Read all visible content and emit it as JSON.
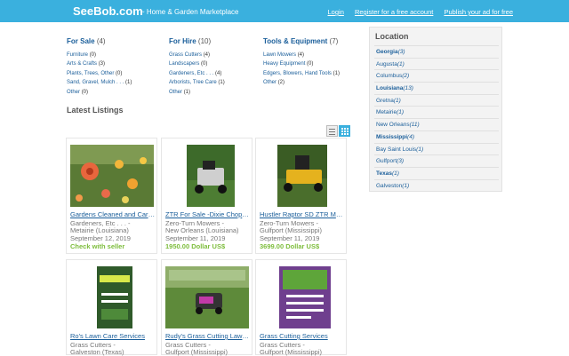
{
  "header": {
    "brand": "SeeBob.com",
    "tagline": "~ Home & Garden Marketplace",
    "links": {
      "login": "Login",
      "register": "Register for a free account",
      "publish": "Publish your ad for free"
    }
  },
  "categories": [
    {
      "name": "For Sale",
      "count": "(4)",
      "items": [
        {
          "name": "Furniture",
          "count": "(0)"
        },
        {
          "name": "Arts & Crafts",
          "count": "(3)"
        },
        {
          "name": "Plants, Trees, Other",
          "count": "(0)"
        },
        {
          "name": "Sand, Gravel, Mulch . . .",
          "count": "(1)"
        },
        {
          "name": "Other",
          "count": "(0)"
        }
      ]
    },
    {
      "name": "For Hire",
      "count": "(10)",
      "items": [
        {
          "name": "Grass Cutters",
          "count": "(4)"
        },
        {
          "name": "Landscapers",
          "count": "(0)"
        },
        {
          "name": "Gardeners, Etc . . .",
          "count": "(4)"
        },
        {
          "name": "Arborists, Tree Care",
          "count": "(1)"
        },
        {
          "name": "Other",
          "count": "(1)"
        }
      ]
    },
    {
      "name": "Tools & Equipment",
      "count": "(7)",
      "items": [
        {
          "name": "Lawn Mowers",
          "count": "(4)"
        },
        {
          "name": "Heavy Equipment",
          "count": "(0)"
        },
        {
          "name": "Edgers, Blowers, Hand Tools",
          "count": "(1)"
        },
        {
          "name": "Other",
          "count": "(2)"
        }
      ]
    }
  ],
  "latest_title": "Latest Listings",
  "listings": [
    {
      "title": "Gardens Cleaned and Cared For",
      "cat": "Gardeners, Etc . . . -",
      "loc": "Metairie (Louisiana)",
      "date": "September 12, 2019",
      "price": "Check with seller"
    },
    {
      "title": "ZTR For Sale -Dixie Chopper",
      "cat": "Zero-Turn Mowers -",
      "loc": "New Orleans (Louisiana)",
      "date": "September 11, 2019",
      "price": "1950.00 Dollar US$"
    },
    {
      "title": "Hustler Raptor SD ZTR Mower",
      "cat": "Zero-Turn Mowers -",
      "loc": "Gulfport (Mississippi)",
      "date": "September 11, 2019",
      "price": "3699.00 Dollar US$"
    },
    {
      "title": "Ro's Lawn Care Services",
      "cat": "Grass Cutters -",
      "loc": "Galveston (Texas)",
      "date": "",
      "price": ""
    },
    {
      "title": "Rudy's Grass Cutting Lawn Service",
      "cat": "Grass Cutters -",
      "loc": "Gulfport (Mississippi)",
      "date": "",
      "price": ""
    },
    {
      "title": "Grass Cutting Services",
      "cat": "Grass Cutters -",
      "loc": "Gulfport (Mississippi)",
      "date": "",
      "price": ""
    }
  ],
  "location": {
    "title": "Location",
    "rows": [
      {
        "name": "Georgia",
        "count": "(3)",
        "state": true
      },
      {
        "name": "Augusta",
        "count": "(1)",
        "state": false
      },
      {
        "name": "Columbus",
        "count": "(2)",
        "state": false
      },
      {
        "name": "Louisiana",
        "count": "(13)",
        "state": true
      },
      {
        "name": "Gretna",
        "count": "(1)",
        "state": false
      },
      {
        "name": "Metairie",
        "count": "(1)",
        "state": false
      },
      {
        "name": "New Orleans",
        "count": "(11)",
        "state": false
      },
      {
        "name": "Mississippi",
        "count": "(4)",
        "state": true
      },
      {
        "name": "Bay Saint Louis",
        "count": "(1)",
        "state": false
      },
      {
        "name": "Gulfport",
        "count": "(3)",
        "state": false
      },
      {
        "name": "Texas",
        "count": "(1)",
        "state": true
      },
      {
        "name": "Galveston",
        "count": "(1)",
        "state": false
      }
    ]
  },
  "colors": {
    "accent": "#3ab0de",
    "link": "#1a5e9a",
    "price": "#7dbd3c"
  }
}
